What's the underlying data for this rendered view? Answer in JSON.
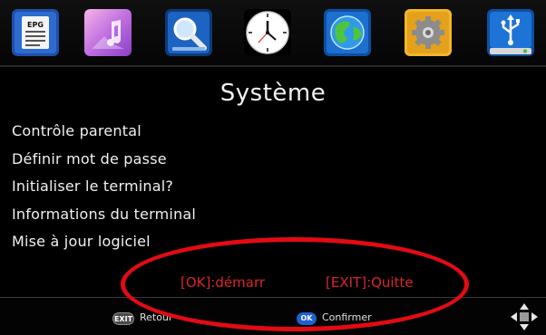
{
  "screen": {
    "title": "Système",
    "top_icons": [
      {
        "name": "epg-icon",
        "label": "EPG"
      },
      {
        "name": "media-icon",
        "label": ""
      },
      {
        "name": "search-icon",
        "label": ""
      },
      {
        "name": "clock-icon",
        "label": ""
      },
      {
        "name": "globe-icon",
        "label": ""
      },
      {
        "name": "settings-gear-icon",
        "label": ""
      },
      {
        "name": "usb-icon",
        "label": ""
      }
    ],
    "selected_icon": "settings-gear-icon"
  },
  "menu": {
    "items": [
      {
        "label": "Contrôle parental"
      },
      {
        "label": "Définir mot de passe"
      },
      {
        "label": "Initialiser le terminal?"
      },
      {
        "label": "Informations du terminal"
      },
      {
        "label": "Mise à jour logiciel"
      }
    ]
  },
  "hints": {
    "ok": "[OK]:démarr",
    "exit": "[EXIT]:Quitte"
  },
  "bottom_bar": {
    "exit_badge": "EXIT",
    "exit_label": "Retour",
    "ok_badge": "OK",
    "ok_label": "Confirmer"
  },
  "colors": {
    "hint_red": "#d8262b",
    "annotation_red": "#e30b13",
    "ok_blue": "#1f5fd6",
    "selected_tile": "#f3b62a"
  }
}
